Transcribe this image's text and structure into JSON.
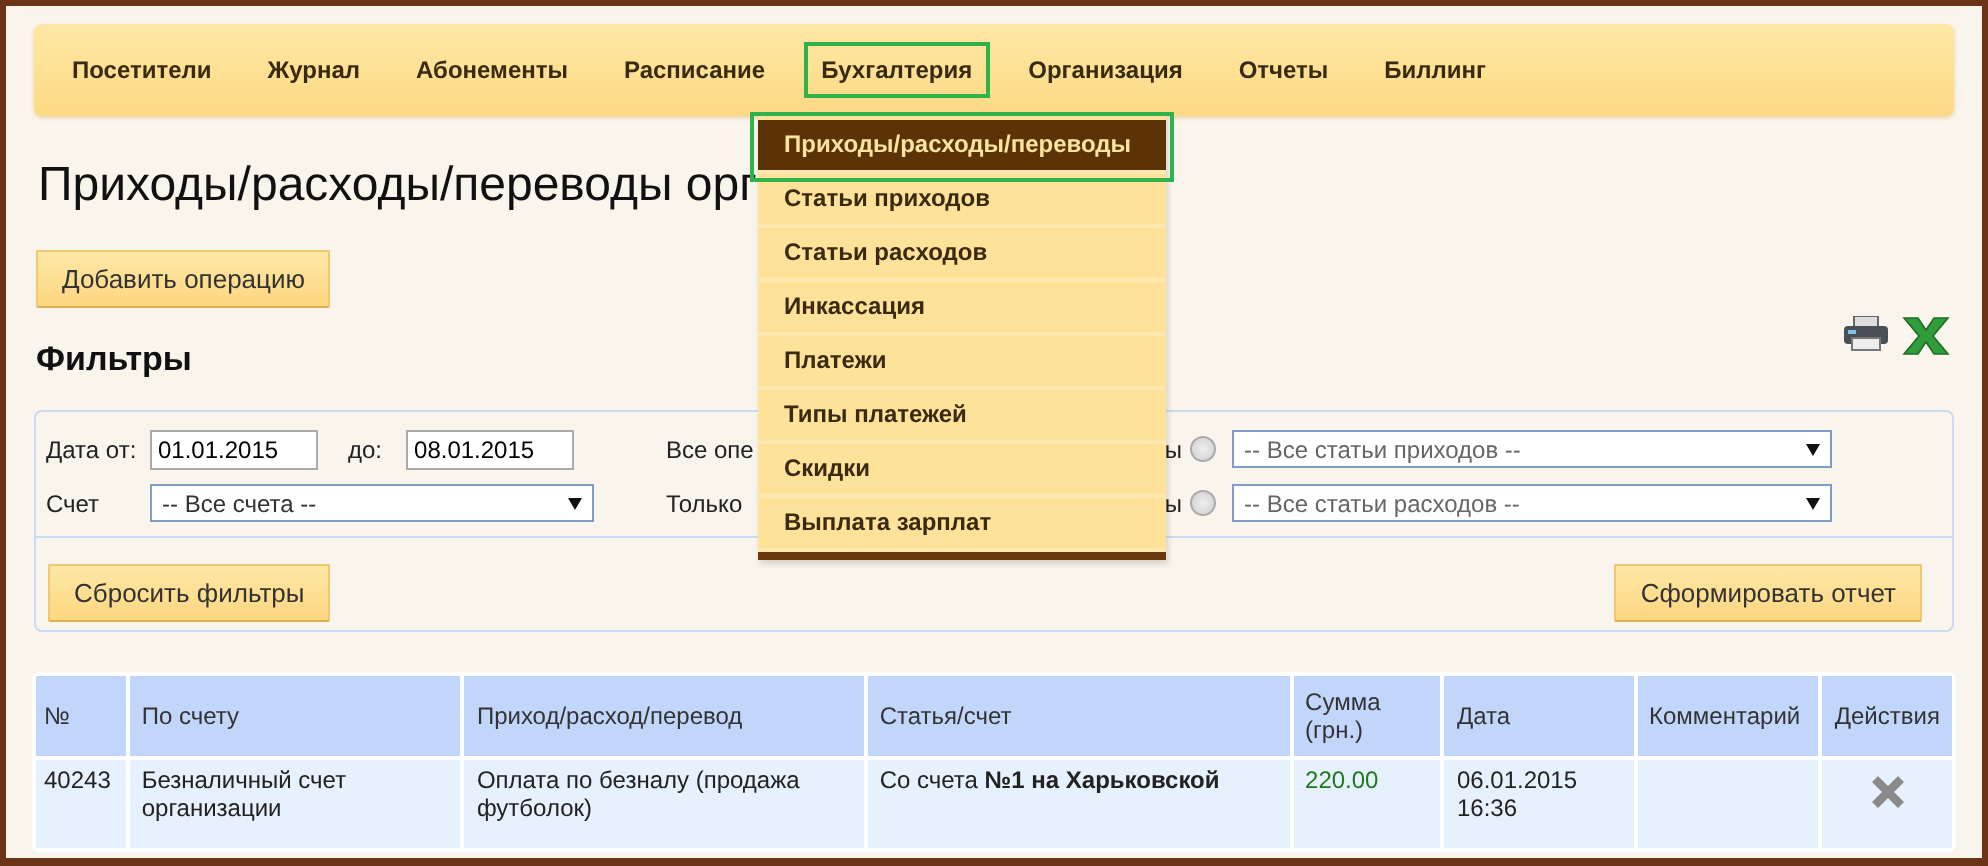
{
  "nav": [
    {
      "label": "Посетители",
      "highlighted": false
    },
    {
      "label": "Журнал",
      "highlighted": false
    },
    {
      "label": "Абонементы",
      "highlighted": false
    },
    {
      "label": "Расписание",
      "highlighted": false
    },
    {
      "label": "Бухгалтерия",
      "highlighted": true
    },
    {
      "label": "Организация",
      "highlighted": false
    },
    {
      "label": "Отчеты",
      "highlighted": false
    },
    {
      "label": "Биллинг",
      "highlighted": false
    }
  ],
  "menu": [
    {
      "label": "Приходы/расходы/переводы",
      "selected": true,
      "highlighted": true
    },
    {
      "label": "Статьи приходов",
      "selected": false,
      "highlighted": false
    },
    {
      "label": "Статьи расходов",
      "selected": false,
      "highlighted": false
    },
    {
      "label": "Инкассация",
      "selected": false,
      "highlighted": false
    },
    {
      "label": "Платежи",
      "selected": false,
      "highlighted": false
    },
    {
      "label": "Типы платежей",
      "selected": false,
      "highlighted": false
    },
    {
      "label": "Скидки",
      "selected": false,
      "highlighted": false
    },
    {
      "label": "Выплата зарплат",
      "selected": false,
      "highlighted": false
    }
  ],
  "page_title": "Приходы/расходы/переводы орг",
  "add_button": "Добавить операцию",
  "filters_title": "Фильтры",
  "filters": {
    "date_from_label": "Дата от:",
    "date_from": "01.01.2015",
    "date_to_label": "до:",
    "date_to": "08.01.2015",
    "account_label": "Счет",
    "account": "-- Все счета --",
    "rows": [
      {
        "label_start": "Все опе",
        "label_end": "ы",
        "checked": false,
        "select": "-- Все статьи приходов --"
      },
      {
        "label_start": "Только",
        "label_end": "ы",
        "checked": false,
        "select": "-- Все статьи расходов --"
      }
    ],
    "reset_button": "Сбросить фильтры",
    "report_button": "Сформировать отчет"
  },
  "table": {
    "columns": [
      "№",
      "По счету",
      "Приход/расход/перевод",
      "Статья/счет",
      "Сумма (грн.)",
      "Дата",
      "Комментарий",
      "Действия"
    ],
    "rows": [
      {
        "number": "40243",
        "account": "Безналичный счет организации",
        "operation": "Оплата по безналу (продажа футболок)",
        "article": "Со счета **№1 на Харьковской**",
        "amount": "220.00",
        "date": "06.01.2015 16:36",
        "comment": ""
      }
    ]
  }
}
